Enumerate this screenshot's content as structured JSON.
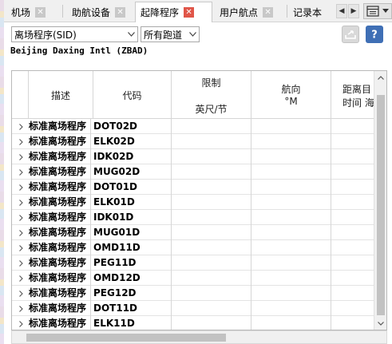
{
  "tabs": [
    {
      "label": "机场",
      "active": false
    },
    {
      "label": "助航设备",
      "active": false
    },
    {
      "label": "起降程序",
      "active": true
    },
    {
      "label": "用户航点",
      "active": false
    },
    {
      "label": "记录本",
      "active": false
    }
  ],
  "filters": {
    "procedure_type": "离场程序(SID)",
    "runway": "所有跑道"
  },
  "airport_title": "Beijing Daxing Intl (ZBAD)",
  "table": {
    "headers": {
      "description": "描述",
      "code": "代码",
      "limit_top": "限制",
      "limit_unit": "英尺/节",
      "course_top": "航向",
      "course_unit": "°M",
      "distance_top": "距离目",
      "distance_unit": "时间 海"
    },
    "rows": [
      {
        "description": "标准离场程序",
        "code": "DOT02D"
      },
      {
        "description": "标准离场程序",
        "code": "ELK02D"
      },
      {
        "description": "标准离场程序",
        "code": "IDK02D"
      },
      {
        "description": "标准离场程序",
        "code": "MUG02D"
      },
      {
        "description": "标准离场程序",
        "code": "DOT01D"
      },
      {
        "description": "标准离场程序",
        "code": "ELK01D"
      },
      {
        "description": "标准离场程序",
        "code": "IDK01D"
      },
      {
        "description": "标准离场程序",
        "code": "MUG01D"
      },
      {
        "description": "标准离场程序",
        "code": "OMD11D"
      },
      {
        "description": "标准离场程序",
        "code": "PEG11D"
      },
      {
        "description": "标准离场程序",
        "code": "OMD12D"
      },
      {
        "description": "标准离场程序",
        "code": "PEG12D"
      },
      {
        "description": "标准离场程序",
        "code": "DOT11D"
      },
      {
        "description": "标准离场程序",
        "code": "ELK11D"
      }
    ]
  },
  "colors": {
    "active_close": "#e05548",
    "help_button": "#3f6fb5"
  }
}
